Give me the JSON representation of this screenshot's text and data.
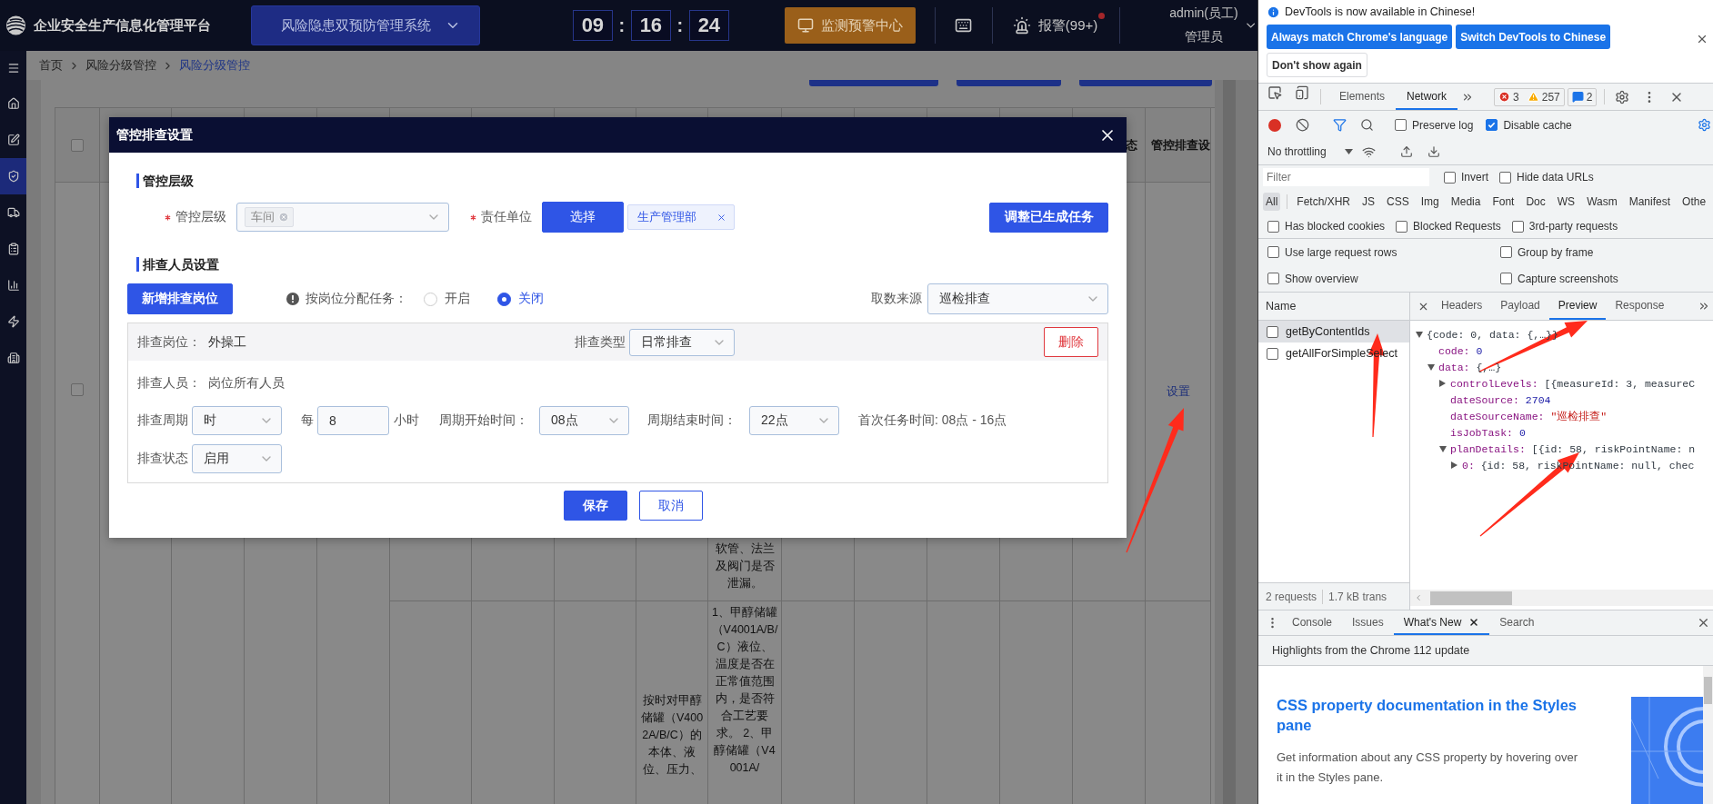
{
  "header": {
    "title": "企业安全生产信息化管理平台",
    "system": "风险隐患双预防管理系统",
    "clock": {
      "parts": [
        "09",
        "16",
        "24"
      ],
      "separators": [
        ":",
        ":"
      ]
    },
    "monitor": "监测预警中心",
    "alarm": {
      "label": "报警(99+)",
      "dot": true
    },
    "user": "admin(员工)",
    "role": "管理员"
  },
  "sidebar": {
    "items": [
      {
        "selected": false
      },
      {
        "selected": false
      },
      {
        "selected": false
      },
      {
        "selected": true
      },
      {
        "selected": false
      },
      {
        "selected": false
      },
      {
        "selected": false
      },
      {
        "selected": false
      },
      {
        "selected": false
      }
    ]
  },
  "breadcrumb": [
    {
      "label": "首页",
      "selected": false
    },
    {
      "label": "风险分级管控",
      "selected": false
    },
    {
      "label": "风险分级管控",
      "selected": true
    }
  ],
  "table": {
    "select_all": {
      "checked": false
    },
    "columns": {
      "column_15": "态",
      "column_16": "管控排查设"
    },
    "rows": [
      {
        "checked": false,
        "column_10": "软管、法兰及阀门是否泄漏。",
        "action": "设置"
      },
      {
        "column_9": "按时对甲醇储罐（V4002A/B/C）的本体、液位、压力、",
        "column_10": "1、甲醇储罐（V4001A/B/C）液位、温度是否在正常值范围内，是否符合工艺要求。 2、甲醇储罐（V4001A/"
      }
    ]
  },
  "dialog": {
    "title": "管控排查设置",
    "control_section": {
      "heading": "管控层级",
      "level_label": "管控层级",
      "level_required": true,
      "level_tags": [
        "车间"
      ],
      "unit_label": "责任单位",
      "unit_required": true,
      "choose_button": "选择",
      "unit_tags": [
        "生产管理部"
      ],
      "adjust_button": "调整已生成任务"
    },
    "staff_section": {
      "heading": "排查人员设置",
      "add_button": "新增排查岗位",
      "assign_label": "按岗位分配任务：",
      "assign_options": [
        {
          "label": "开启",
          "selected": false
        },
        {
          "label": "关闭",
          "selected": true
        }
      ],
      "source_label": "取数来源",
      "source_value": "巡检排查"
    },
    "posts": [
      {
        "post_label": "排查岗位：",
        "post": "外操工",
        "type_label": "排查类型",
        "type_value": "日常排查",
        "delete_button": "删除",
        "staff_label": "排查人员：",
        "staff": "岗位所有人员",
        "cycle_label": "排查周期",
        "cycle_value": "时",
        "every_label": "每",
        "every_value": "8",
        "every_unit": "小时",
        "start_label": "周期开始时间：",
        "start_value": "08点",
        "end_label": "周期结束时间：",
        "end_value": "22点",
        "first_task": "首次任务时间: 08点 - 16点",
        "status_label": "排查状态",
        "status_value": "启用"
      }
    ],
    "buttons": [
      {
        "label": "保存",
        "kind": "primary"
      },
      {
        "label": "取消",
        "kind": "secondary"
      }
    ]
  },
  "devtools": {
    "infobar": {
      "message": "DevTools is now available in Chinese!",
      "buttons": [
        "Always match Chrome's language",
        "Switch DevTools to Chinese"
      ],
      "dismiss": "Don't show again"
    },
    "tabs": [
      {
        "label": "Elements",
        "selected": false
      },
      {
        "label": "Network",
        "selected": true
      }
    ],
    "errors": "3",
    "warnings": "257",
    "messages": "2",
    "toolbar_options": [
      {
        "label": "Preserve log",
        "checked": false
      },
      {
        "label": "Disable cache",
        "checked": true
      }
    ],
    "throttling": "No throttling",
    "filter": {
      "placeholder": "Filter"
    },
    "filter_options": [
      {
        "label": "Invert",
        "checked": false
      },
      {
        "label": "Hide data URLs",
        "checked": false
      }
    ],
    "types": [
      {
        "label": "All",
        "selected": true
      },
      {
        "label": "Fetch/XHR",
        "selected": false
      },
      {
        "label": "JS",
        "selected": false
      },
      {
        "label": "CSS",
        "selected": false
      },
      {
        "label": "Img",
        "selected": false
      },
      {
        "label": "Media",
        "selected": false
      },
      {
        "label": "Font",
        "selected": false
      },
      {
        "label": "Doc",
        "selected": false
      },
      {
        "label": "WS",
        "selected": false
      },
      {
        "label": "Wasm",
        "selected": false
      },
      {
        "label": "Manifest",
        "selected": false
      },
      {
        "label": "Othe",
        "selected": false
      }
    ],
    "request_options": [
      {
        "label": "Has blocked cookies",
        "checked": false
      },
      {
        "label": "Blocked Requests",
        "checked": false
      },
      {
        "label": "3rd-party requests",
        "checked": false
      }
    ],
    "settings": [
      {
        "label": "Use large request rows",
        "checked": false
      },
      {
        "label": "Group by frame",
        "checked": false
      },
      {
        "label": "Show overview",
        "checked": false
      },
      {
        "label": "Capture screenshots",
        "checked": false
      }
    ],
    "requests": {
      "heading": "Name",
      "items": [
        {
          "name": "getByContentIds",
          "selected": true,
          "checked": false
        },
        {
          "name": "getAllForSimpleSelect",
          "selected": false,
          "checked": false
        }
      ],
      "summary": [
        "2 requests",
        "1.7 kB trans"
      ]
    },
    "detail_tabs": [
      {
        "label": "Headers",
        "selected": false
      },
      {
        "label": "Payload",
        "selected": false
      },
      {
        "label": "Preview",
        "selected": true
      },
      {
        "label": "Response",
        "selected": false
      }
    ],
    "preview": [
      {
        "kind": "object",
        "expanded": true,
        "value": "{code: 0, data: {,…}}",
        "children": [
          {
            "kind": "number",
            "key": "code:",
            "value": "0"
          },
          {
            "kind": "object",
            "expanded": true,
            "key": "data:",
            "value": "{,…}",
            "children": [
              {
                "kind": "object",
                "expanded": false,
                "key": "controlLevels:",
                "value": "[{measureId: 3, measureC"
              },
              {
                "kind": "number",
                "key": "dateSource:",
                "value": "2704"
              },
              {
                "kind": "string",
                "key": "dateSourceName:",
                "value": "\"巡检排查\""
              },
              {
                "kind": "number",
                "key": "isJobTask:",
                "value": "0"
              },
              {
                "kind": "object",
                "expanded": true,
                "key": "planDetails:",
                "value": "[{id: 58, riskPointName: n",
                "children": [
                  {
                    "kind": "object",
                    "expanded": false,
                    "key": "0:",
                    "value": "{id: 58, riskPointName: null, chec"
                  }
                ]
              }
            ]
          }
        ]
      }
    ],
    "drawer": {
      "tabs": [
        {
          "label": "Console",
          "selected": false,
          "closable": false
        },
        {
          "label": "Issues",
          "selected": false,
          "closable": false
        },
        {
          "label": "What's New",
          "selected": true,
          "closable": true
        },
        {
          "label": "Search",
          "selected": false,
          "closable": false
        }
      ],
      "banner": "Highlights from the Chrome 112 update",
      "article": {
        "title": "CSS property documentation in the Styles pane",
        "body": "Get information about any CSS property by hovering over it in the Styles pane."
      }
    }
  }
}
